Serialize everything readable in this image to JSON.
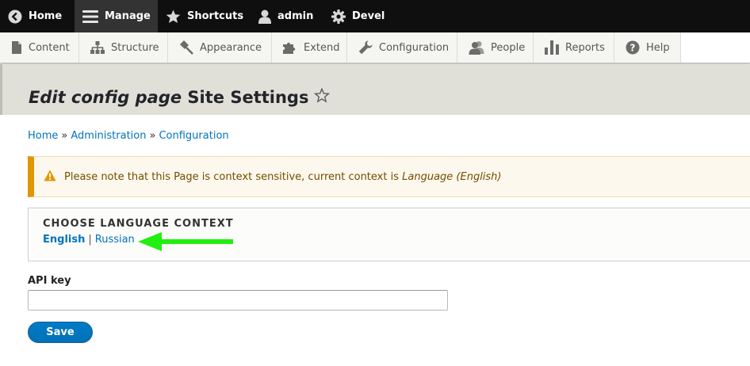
{
  "toolbar": {
    "items": [
      {
        "label": "Home",
        "icon": "home-icon"
      },
      {
        "label": "Manage",
        "icon": "hamburger-menu-icon"
      },
      {
        "label": "Shortcuts",
        "icon": "star-icon"
      },
      {
        "label": "admin",
        "icon": "user-icon"
      },
      {
        "label": "Devel",
        "icon": "gear-icon"
      }
    ],
    "active": "Manage"
  },
  "tray": {
    "items": [
      {
        "label": "Content",
        "icon": "file-icon"
      },
      {
        "label": "Structure",
        "icon": "sitemap-icon"
      },
      {
        "label": "Appearance",
        "icon": "paintbrush-icon"
      },
      {
        "label": "Extend",
        "icon": "puzzle-icon"
      },
      {
        "label": "Configuration",
        "icon": "wrench-icon"
      },
      {
        "label": "People",
        "icon": "people-icon"
      },
      {
        "label": "Reports",
        "icon": "bar-chart-icon"
      },
      {
        "label": "Help",
        "icon": "help-icon"
      }
    ]
  },
  "page": {
    "title_prefix": "Edit config page",
    "title_name": "Site Settings"
  },
  "breadcrumb": {
    "items": [
      "Home",
      "Administration",
      "Configuration"
    ],
    "separator": "»"
  },
  "warning": {
    "text": "Please note that this Page is context sensitive, current context is",
    "context": "Language (English)"
  },
  "language_context": {
    "title": "Choose language context",
    "options": [
      "English",
      "Russian"
    ],
    "separator": "|",
    "current": "English"
  },
  "form": {
    "api_key_label": "API key",
    "api_key_value": "",
    "save_label": "Save"
  },
  "colors": {
    "toolbar_bg": "#0f0f0f",
    "link": "#0074bd",
    "warning_accent": "#e09600",
    "button": "#0071b8",
    "annotation_arrow": "#22ee11"
  }
}
